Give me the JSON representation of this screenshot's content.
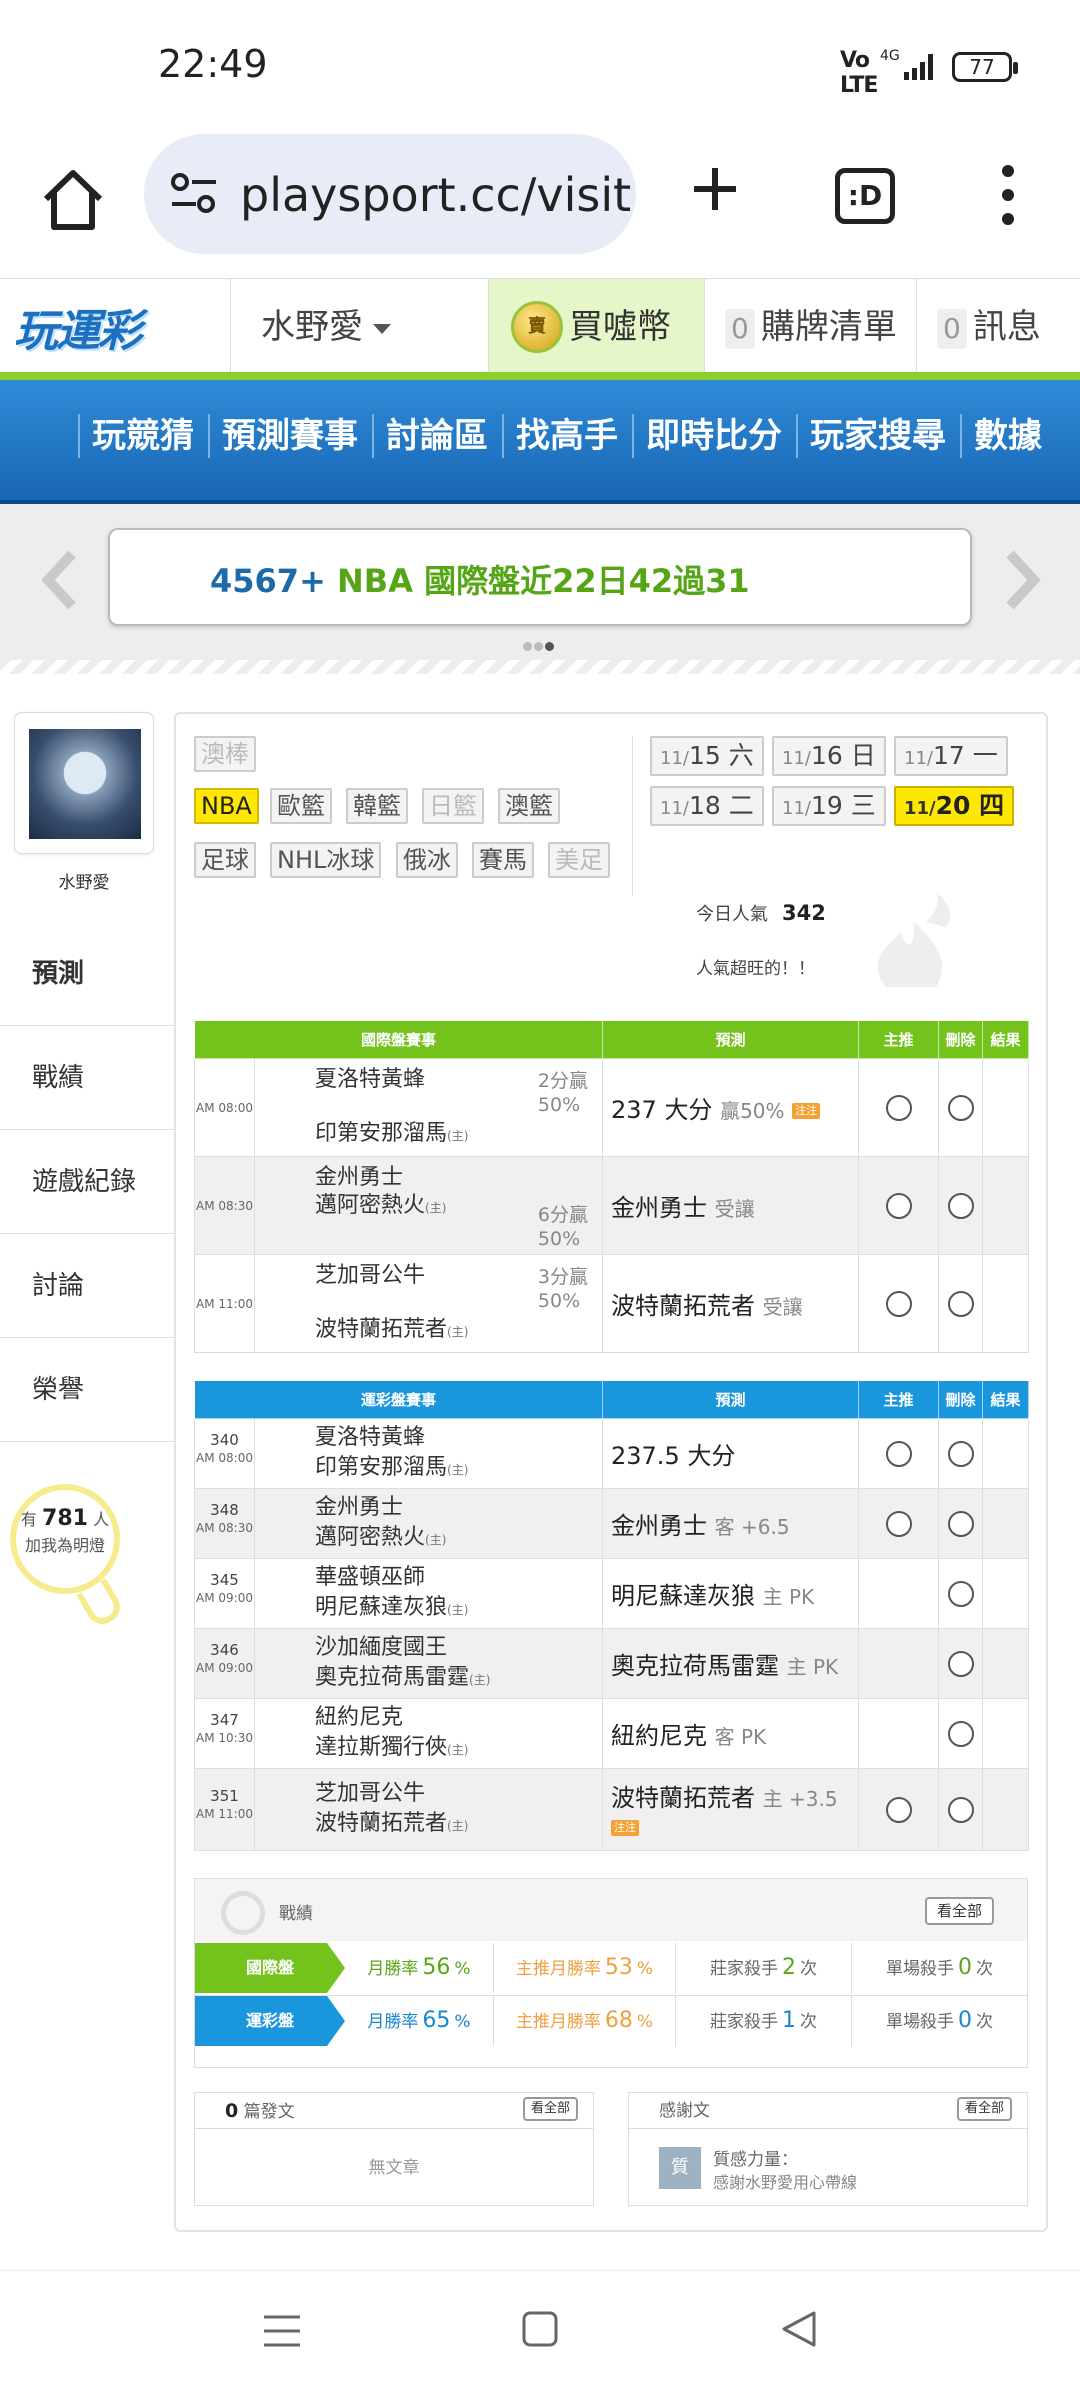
{
  "status": {
    "time": "22:49",
    "network": "4G",
    "battery": "77"
  },
  "browser": {
    "url": "playsport.cc/visit",
    "tabs_label": ":D"
  },
  "header": {
    "logo": "玩運彩",
    "user": "水野愛",
    "coin_icon": "賣",
    "buy_coins": "買噓幣",
    "cart_count": "0",
    "cart": "購牌清單",
    "msg_count": "0",
    "messages": "訊息"
  },
  "nav": [
    "玩競猜",
    "預測賽事",
    "討論區",
    "找高手",
    "即時比分",
    "玩家搜尋",
    "數據"
  ],
  "banner": {
    "num": "4567+",
    "text": "NBA 國際盤近22日42過31"
  },
  "sidebar": {
    "username": "水野愛",
    "items": [
      "預測",
      "戰績",
      "遊戲紀錄",
      "討論",
      "榮譽"
    ],
    "bulb_pre": "有",
    "bulb_count": "781",
    "bulb_unit": "人",
    "bulb_text": "加我為明燈"
  },
  "sports": {
    "row0": [
      "澳棒"
    ],
    "row1": [
      "NBA",
      "歐籃",
      "韓籃",
      "日籃",
      "澳籃"
    ],
    "row2": [
      "足球",
      "NHL冰球",
      "俄冰",
      "賽馬",
      "美足"
    ],
    "selected": "NBA"
  },
  "dates": [
    {
      "md": "11/",
      "d": "15",
      "w": "六"
    },
    {
      "md": "11/",
      "d": "16",
      "w": "日"
    },
    {
      "md": "11/",
      "d": "17",
      "w": "一"
    },
    {
      "md": "11/",
      "d": "18",
      "w": "二"
    },
    {
      "md": "11/",
      "d": "19",
      "w": "三"
    },
    {
      "md": "11/",
      "d": "20",
      "w": "四"
    }
  ],
  "popularity": {
    "label": "今日人氣",
    "value": "342",
    "note": "人氣超旺的！！"
  },
  "intl_table": {
    "headers": [
      "國際盤賽事",
      "預測",
      "主推",
      "刪除",
      "結果"
    ],
    "rows": [
      {
        "time": "AM 08:00",
        "away": "夏洛特黃蜂",
        "home": "印第安那溜馬",
        "home_tag": "(主)",
        "r1": "2分贏",
        "r2": "50%",
        "pick": "237 大分",
        "pick_note": "贏50%",
        "badge": "注注"
      },
      {
        "time": "AM 08:30",
        "away": "金州勇士",
        "home": "邁阿密熱火",
        "home_tag": "(主)",
        "r1": "6分贏",
        "r2": "50%",
        "pick": "金州勇士",
        "pick_note": "受讓"
      },
      {
        "time": "AM 11:00",
        "away": "芝加哥公牛",
        "home": "波特蘭拓荒者",
        "home_tag": "(主)",
        "r1": "3分贏",
        "r2": "50%",
        "pick": "波特蘭拓荒者",
        "pick_note": "受讓"
      }
    ]
  },
  "sports_table": {
    "headers": [
      "運彩盤賽事",
      "預測",
      "主推",
      "刪除",
      "結果"
    ],
    "rows": [
      {
        "no": "340",
        "time": "AM 08:00",
        "away": "夏洛特黃蜂",
        "home": "印第安那溜馬",
        "home_tag": "(主)",
        "pick": "237.5 大分",
        "pick_note": ""
      },
      {
        "no": "348",
        "time": "AM 08:30",
        "away": "金州勇士",
        "home": "邁阿密熱火",
        "home_tag": "(主)",
        "pick": "金州勇士",
        "pick_note": "客 +6.5"
      },
      {
        "no": "345",
        "time": "AM 09:00",
        "away": "華盛頓巫師",
        "home": "明尼蘇達灰狼",
        "home_tag": "(主)",
        "pick": "明尼蘇達灰狼",
        "pick_note": "主 PK"
      },
      {
        "no": "346",
        "time": "AM 09:00",
        "away": "沙加緬度國王",
        "home": "奧克拉荷馬雷霆",
        "home_tag": "(主)",
        "pick": "奧克拉荷馬雷霆",
        "pick_note": "主 PK"
      },
      {
        "no": "347",
        "time": "AM 10:30",
        "away": "紐約尼克",
        "home": "達拉斯獨行俠",
        "home_tag": "(主)",
        "pick": "紐約尼克",
        "pick_note": "客 PK"
      },
      {
        "no": "351",
        "time": "AM 11:00",
        "away": "芝加哥公牛",
        "home": "波特蘭拓荒者",
        "home_tag": "(主)",
        "pick": "波特蘭拓荒者",
        "pick_note": "主 +3.5",
        "badge": "注注"
      }
    ]
  },
  "record": {
    "title": "戰績",
    "see_all": "看全部",
    "rows": [
      {
        "label": "國際盤",
        "m_label": "月勝率",
        "m_val": "56",
        "p_label": "主推月勝率",
        "p_val": "53",
        "pct": "%",
        "k_label": "莊家殺手",
        "k_val": "2",
        "s_label": "單場殺手",
        "s_val": "0",
        "unit": "次"
      },
      {
        "label": "運彩盤",
        "m_label": "月勝率",
        "m_val": "65",
        "p_label": "主推月勝率",
        "p_val": "68",
        "pct": "%",
        "k_label": "莊家殺手",
        "k_val": "1",
        "s_label": "單場殺手",
        "s_val": "0",
        "unit": "次"
      }
    ]
  },
  "posts": {
    "count": "0",
    "label": "篇發文",
    "see_all": "看全部",
    "empty": "無文章"
  },
  "thanks": {
    "title": "感謝文",
    "see_all": "看全部",
    "icon": "質",
    "line1": "質感力量：",
    "line2": "感謝水野愛用心帶線"
  },
  "colors": {
    "intl_header": "#74c31d",
    "sports_header": "#1a96dc",
    "highlight": "#ffe800"
  }
}
